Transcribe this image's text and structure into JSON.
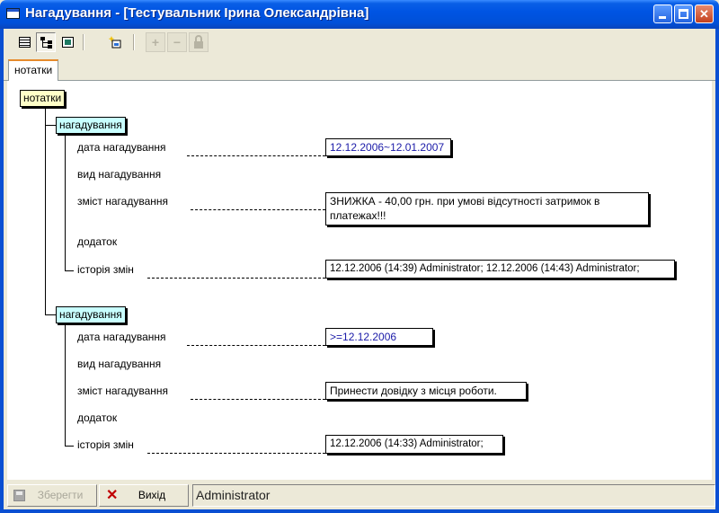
{
  "window": {
    "title": "Нагадування - [Тестувальник Ірина Олександрівна]"
  },
  "toolbar": {
    "buttons": [
      {
        "icon": "grid-view-icon",
        "state": "normal"
      },
      {
        "icon": "tree-view-icon",
        "state": "pressed"
      },
      {
        "icon": "form-view-icon",
        "state": "normal"
      },
      {
        "icon": "new-record-icon",
        "state": "normal"
      },
      {
        "icon": "plus-icon",
        "state": "disabled"
      },
      {
        "icon": "minus-icon",
        "state": "disabled"
      },
      {
        "icon": "lock-icon",
        "state": "disabled"
      }
    ]
  },
  "tabs": [
    {
      "label": "нотатки",
      "active": true
    }
  ],
  "tree": {
    "root": "нотатки",
    "sections": [
      {
        "title": "нагадування",
        "fields": [
          {
            "label": "дата нагадування",
            "value": "12.12.2006~12.01.2007"
          },
          {
            "label": "вид нагадування",
            "value": ""
          },
          {
            "label": "зміст нагадування",
            "value": "ЗНИЖКА - 40,00 грн. при умові відсутності затримок в платежах!!!"
          },
          {
            "label": "додаток",
            "value": ""
          },
          {
            "label": "історія змін",
            "value": "12.12.2006 (14:39) Administrator; 12.12.2006 (14:43) Administrator;"
          }
        ]
      },
      {
        "title": "нагадування",
        "fields": [
          {
            "label": "дата нагадування",
            "value": ">=12.12.2006"
          },
          {
            "label": "вид нагадування",
            "value": ""
          },
          {
            "label": "зміст нагадування",
            "value": "Принести довідку з місця роботи."
          },
          {
            "label": "додаток",
            "value": ""
          },
          {
            "label": "історія змін",
            "value": "12.12.2006 (14:33) Administrator;"
          }
        ]
      }
    ]
  },
  "statusbar": {
    "save_label": "Зберегти",
    "exit_label": "Вихід",
    "user": "Administrator"
  }
}
